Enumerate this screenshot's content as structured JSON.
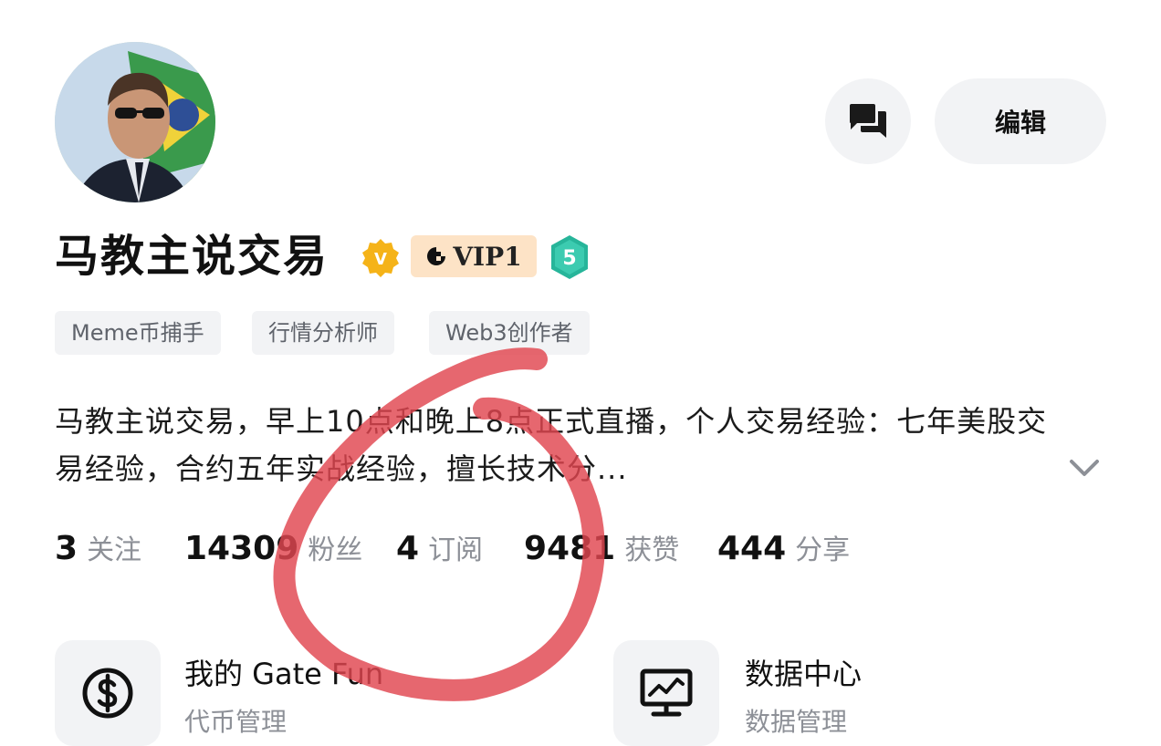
{
  "profile": {
    "name": "马教主说交易",
    "vip_label": "VIP1",
    "level": "5",
    "tags": [
      "Meme币捕手",
      "行情分析师",
      "Web3创作者"
    ],
    "bio": "马教主说交易，早上10点和晚上8点正式直播，个人交易经验：七年美股交易经验，合约五年实战经验，擅长技术分..."
  },
  "actions": {
    "message_icon": "chat-bubbles-icon",
    "edit_label": "编辑"
  },
  "stats": [
    {
      "value": "3",
      "label": "关注"
    },
    {
      "value": "14309",
      "label": "粉丝"
    },
    {
      "value": "4",
      "label": "订阅"
    },
    {
      "value": "9481",
      "label": "获赞"
    },
    {
      "value": "444",
      "label": "分享"
    }
  ],
  "tools": [
    {
      "title": "我的 Gate Fun",
      "subtitle": "代币管理",
      "icon": "dollar-circle-icon"
    },
    {
      "title": "数据中心",
      "subtitle": "数据管理",
      "icon": "monitor-chart-icon"
    }
  ],
  "colors": {
    "verify_badge": "#f5b318",
    "vip_bg": "#fde3c6",
    "level_badge": "#27b59a",
    "annotation": "#e0454f",
    "pill_bg": "#f2f3f5"
  }
}
